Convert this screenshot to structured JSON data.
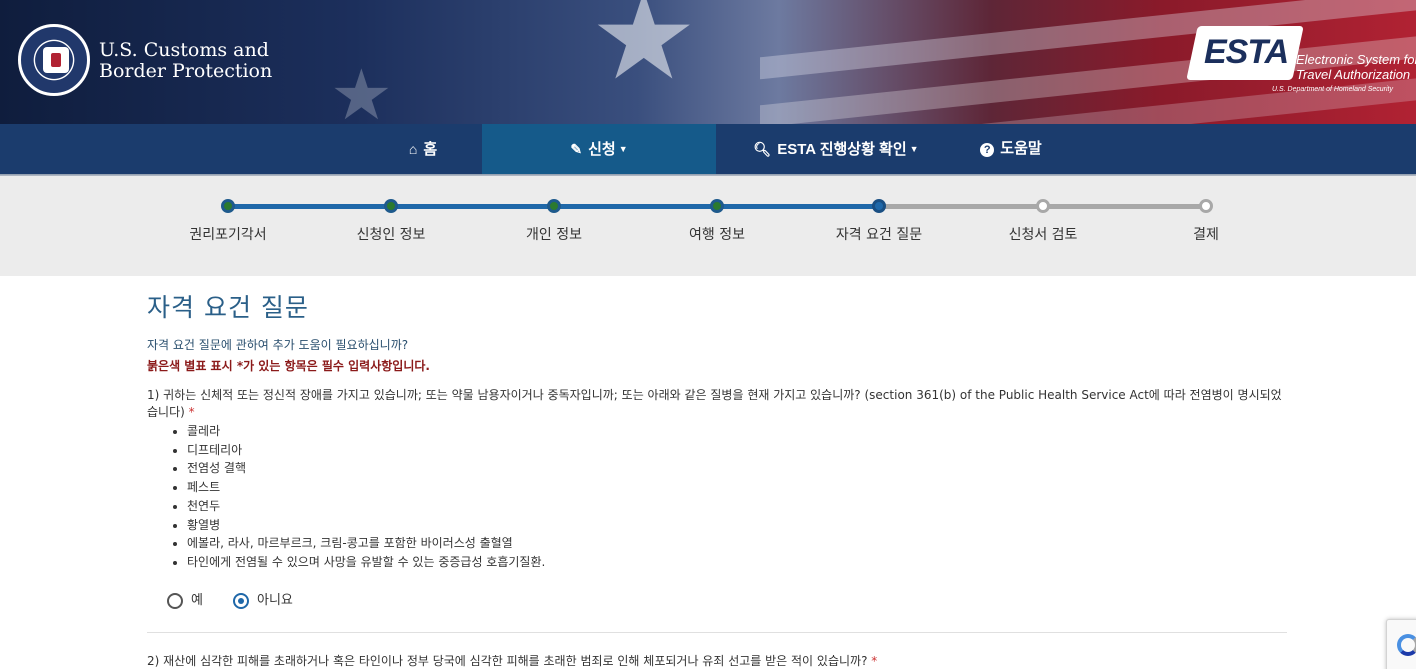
{
  "header": {
    "agency_line1": "U.S. Customs and",
    "agency_line2": "Border Protection",
    "esta_logo": "ESTA",
    "esta_subtitle_line1": "Electronic System for",
    "esta_subtitle_line2": "Travel Authorization",
    "esta_dhs": "U.S. Department of Homeland Security"
  },
  "nav": {
    "items": [
      {
        "label": "홈",
        "icon": "home-icon",
        "glyph": "⌂"
      },
      {
        "label": "신청",
        "icon": "pencil-icon",
        "glyph": "✎"
      },
      {
        "label": "ESTA 진행상황 확인",
        "icon": "search-icon",
        "glyph": "🔍︎"
      },
      {
        "label": "도움말",
        "icon": "question-circle-icon",
        "glyph": "?"
      }
    ],
    "active_index": 1,
    "colors": {
      "bar": "#1b3c6d",
      "active": "#155a8a"
    }
  },
  "progress": {
    "steps": [
      {
        "label": "권리포기각서",
        "status": "complete"
      },
      {
        "label": "신청인 정보",
        "status": "complete"
      },
      {
        "label": "개인 정보",
        "status": "complete"
      },
      {
        "label": "여행 정보",
        "status": "complete"
      },
      {
        "label": "자격 요건 질문",
        "status": "current"
      },
      {
        "label": "신청서 검토",
        "status": "pending"
      },
      {
        "label": "결제",
        "status": "pending"
      }
    ]
  },
  "content": {
    "title": "자격 요건 질문",
    "help_text": "자격 요건 질문에 관하여 추가 도움이 필요하십니까?",
    "required_note": "붉은색 별표 표시 *가 있는 항목은 필수 입력사항입니다.",
    "question1": {
      "text": "1) 귀하는 신체적 또는 정신적 장애를 가지고 있습니까; 또는 약물 남용자이거나 중독자입니까; 또는 아래와 같은 질병을 현재 가지고 있습니까? (section 361(b) of the Public Health Service Act에 따라 전염병이 명시되었습니다)",
      "required_mark": "*",
      "diseases": [
        "콜레라",
        "디프테리아",
        "전염성 결핵",
        "페스트",
        "천연두",
        "황열병",
        "에볼라, 라사, 마르부르크, 크림-콩고를 포함한 바이러스성 출혈열",
        "타인에게 전염될 수 있으며 사망을 유발할 수 있는 중증급성 호흡기질환."
      ],
      "options": [
        {
          "label": "예",
          "checked": false
        },
        {
          "label": "아니요",
          "checked": true
        }
      ]
    },
    "question2": {
      "text": "2) 재산에 심각한 피해를 초래하거나 혹은 타인이나 정부 당국에 심각한 피해를 초래한 범죄로 인해 체포되거나 유죄 선고를 받은 적이 있습니까?",
      "required_mark": "*"
    }
  }
}
